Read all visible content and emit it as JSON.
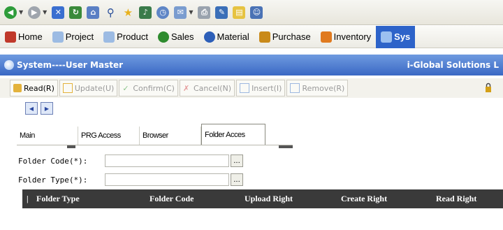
{
  "browser_toolbar": {
    "icons": [
      "back-icon",
      "forward-icon",
      "stop-icon",
      "refresh-icon",
      "home-icon",
      "search-icon",
      "favorites-icon",
      "media-icon",
      "history-icon",
      "mail-icon",
      "print-icon",
      "edit-icon",
      "discuss-icon",
      "messenger-icon"
    ]
  },
  "module_menu": {
    "items": [
      {
        "label": "Home",
        "color": "#c0392b"
      },
      {
        "label": "Project",
        "color": "#7da7d9"
      },
      {
        "label": "Product",
        "color": "#7da7d9"
      },
      {
        "label": "Sales",
        "color": "#2e8b2e"
      },
      {
        "label": "Material",
        "color": "#2d5fb8"
      },
      {
        "label": "Purchase",
        "color": "#c98a1a"
      },
      {
        "label": "Inventory",
        "color": "#e07a1f"
      },
      {
        "label": "Sys",
        "color": "#ffffff"
      }
    ]
  },
  "title_bar": {
    "title": "System----User Master",
    "company": "i-Global Solutions L"
  },
  "actions": [
    {
      "label": "Read(R)",
      "enabled": true
    },
    {
      "label": "Update(U)",
      "enabled": false
    },
    {
      "label": "Confirm(C)",
      "enabled": false
    },
    {
      "label": "Cancel(N)",
      "enabled": false
    },
    {
      "label": "Insert(I)",
      "enabled": false
    },
    {
      "label": "Remove(R)",
      "enabled": false
    }
  ],
  "tabs": [
    {
      "label": "Main"
    },
    {
      "label": "PRG Access"
    },
    {
      "label": "Browser"
    },
    {
      "label": "Folder Acces"
    }
  ],
  "form": {
    "folder_code_label": "Folder Code(*):",
    "folder_code_value": "",
    "folder_type_label": "Folder Type(*):",
    "folder_type_value": "",
    "lookup_label": "..."
  },
  "grid": {
    "columns": [
      "Folder Type",
      "Folder Code",
      "Upload Right",
      "Create Right",
      "Read Right"
    ],
    "separator": "|"
  },
  "colors": {
    "title_bar": "#3a68c4",
    "grid_header": "#3a3a3a",
    "active_module": "#2d63c9"
  }
}
